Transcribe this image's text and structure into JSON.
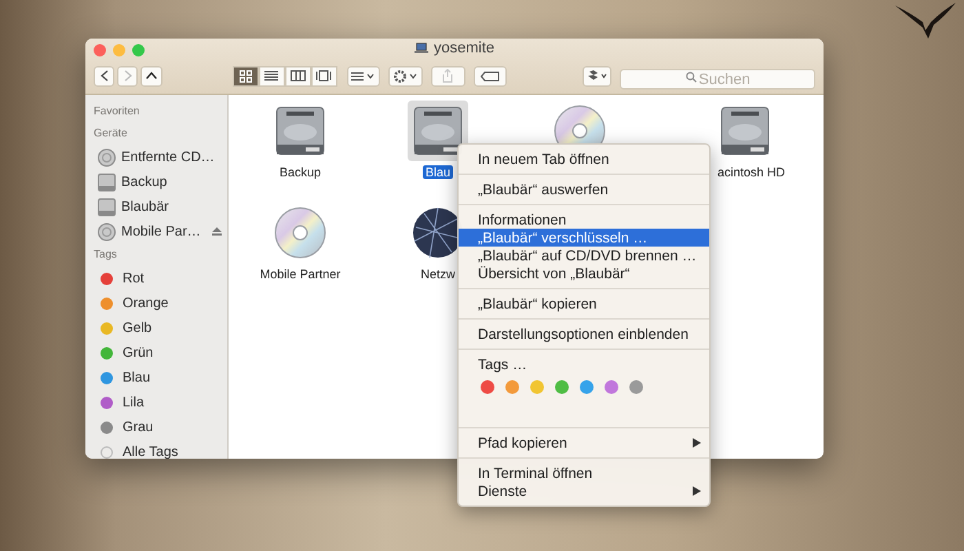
{
  "window": {
    "title": "yosemite"
  },
  "toolbar": {
    "view_modes": [
      {
        "selected": true
      },
      {
        "selected": false
      },
      {
        "selected": false
      },
      {
        "selected": false
      }
    ],
    "share_disabled": true,
    "search": {
      "placeholder": "Suchen"
    }
  },
  "sidebar": {
    "sections": [
      {
        "title": "Favoriten"
      },
      {
        "title": "Geräte",
        "items": [
          {
            "label": "Entfernte CD…",
            "kind": "disc",
            "eject": false
          },
          {
            "label": "Backup",
            "kind": "drive",
            "eject": false
          },
          {
            "label": "Blaubär",
            "kind": "drive",
            "eject": false
          },
          {
            "label": "Mobile Par…",
            "kind": "disc",
            "eject": true
          }
        ]
      },
      {
        "title": "Tags",
        "items": [
          {
            "label": "Rot",
            "kind": "tag",
            "color": "#e5403a"
          },
          {
            "label": "Orange",
            "kind": "tag",
            "color": "#ee8f2c"
          },
          {
            "label": "Gelb",
            "kind": "tag",
            "color": "#e9b824"
          },
          {
            "label": "Grün",
            "kind": "tag",
            "color": "#43b63a"
          },
          {
            "label": "Blau",
            "kind": "tag",
            "color": "#2f96e0"
          },
          {
            "label": "Lila",
            "kind": "tag",
            "color": "#b05cc8"
          },
          {
            "label": "Grau",
            "kind": "tag",
            "color": "#8a8a8a"
          },
          {
            "label": "Alle Tags",
            "kind": "all"
          }
        ]
      }
    ]
  },
  "files": [
    {
      "label": "Backup",
      "kind": "drive",
      "selected": false
    },
    {
      "label": "Blau",
      "kind": "drive",
      "selected": true
    },
    {
      "kind": "disc",
      "selected": false
    },
    {
      "label": "acintosh HD",
      "kind": "drive",
      "selected": false
    },
    {
      "label": "Mobile Partner",
      "kind": "disc",
      "selected": false
    },
    {
      "label": "Netzw",
      "kind": "network",
      "selected": false
    }
  ],
  "context_menu": {
    "groups": [
      {
        "items": [
          {
            "label": "In neuem Tab öffnen",
            "selected": false,
            "submenu": false
          }
        ]
      },
      {
        "items": [
          {
            "label": "„Blaubär“ auswerfen",
            "selected": false,
            "submenu": false
          }
        ]
      },
      {
        "items": [
          {
            "label": "Informationen",
            "selected": false,
            "submenu": false
          },
          {
            "label": "„Blaubär“ verschlüsseln …",
            "selected": true,
            "submenu": false
          },
          {
            "label": "„Blaubär“ auf CD/DVD brennen …",
            "selected": false,
            "submenu": false
          },
          {
            "label": "Übersicht von „Blaubär“",
            "selected": false,
            "submenu": false
          }
        ]
      },
      {
        "items": [
          {
            "label": "„Blaubär“ kopieren",
            "selected": false,
            "submenu": false
          }
        ]
      },
      {
        "items": [
          {
            "label": "Darstellungsoptionen einblenden",
            "selected": false,
            "submenu": false
          }
        ]
      },
      {
        "tags_label": "Tags …",
        "tag_colors": [
          {
            "color": "#ee4b45"
          },
          {
            "color": "#f39a3b"
          },
          {
            "color": "#f1c532"
          },
          {
            "color": "#4fbd44"
          },
          {
            "color": "#36a3ea"
          },
          {
            "color": "#c177dc"
          },
          {
            "color": "#9a9a9a"
          }
        ]
      },
      {
        "items": [
          {
            "label": "Pfad kopieren",
            "selected": false,
            "submenu": true
          }
        ]
      },
      {
        "items": [
          {
            "label": "In Terminal öffnen",
            "selected": false,
            "submenu": false
          },
          {
            "label": "Dienste",
            "selected": false,
            "submenu": true
          }
        ]
      }
    ]
  }
}
